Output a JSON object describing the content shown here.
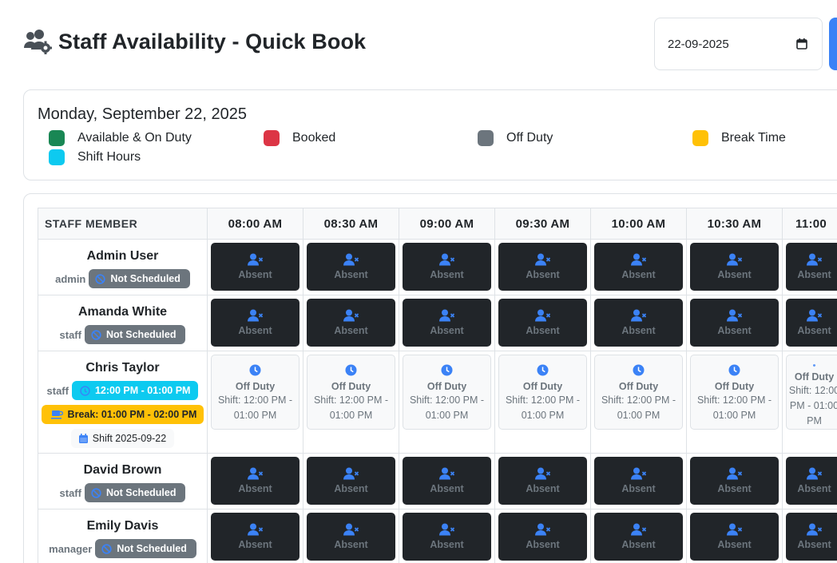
{
  "header": {
    "title": "Staff Availability - Quick Book",
    "icon": "users-cog-icon"
  },
  "date_picker": {
    "value": "22-09-2025",
    "icon": "calendar-icon"
  },
  "legend": {
    "day_title": "Monday, September 22, 2025",
    "items": [
      {
        "label": "Available & On Duty",
        "color": "#198754"
      },
      {
        "label": "Booked",
        "color": "#dc3545"
      },
      {
        "label": "Off Duty",
        "color": "#6c757d"
      },
      {
        "label": "Break Time",
        "color": "#ffc107"
      },
      {
        "label": "Shift Hours",
        "color": "#0dcaf0"
      }
    ]
  },
  "grid": {
    "staff_header": "STAFF MEMBER",
    "time_slots": [
      "08:00 AM",
      "08:30 AM",
      "09:00 AM",
      "09:30 AM",
      "10:00 AM",
      "10:30 AM",
      "11:00"
    ],
    "absent_label": "Absent",
    "off_duty_label": "Off Duty",
    "staff": [
      {
        "name": "Admin User",
        "role": "admin",
        "status": "Not Scheduled",
        "slot_state": "absent"
      },
      {
        "name": "Amanda White",
        "role": "staff",
        "status": "Not Scheduled",
        "slot_state": "absent"
      },
      {
        "name": "Chris Taylor",
        "role": "staff",
        "shift_badge": "12:00 PM - 01:00 PM",
        "break_badge": "Break: 01:00 PM - 02:00 PM",
        "shift_date": "Shift 2025-09-22",
        "slot_state": "off_duty",
        "slot_detail": "Shift: 12:00 PM - 01:00 PM"
      },
      {
        "name": "David Brown",
        "role": "staff",
        "status": "Not Scheduled",
        "slot_state": "absent"
      },
      {
        "name": "Emily Davis",
        "role": "manager",
        "status": "Not Scheduled",
        "slot_state": "absent"
      }
    ]
  },
  "colors": {
    "primary": "#3b82f6",
    "dark_cell": "#212529",
    "muted": "#6c757d",
    "shift": "#0dcaf0",
    "break": "#ffc107"
  }
}
